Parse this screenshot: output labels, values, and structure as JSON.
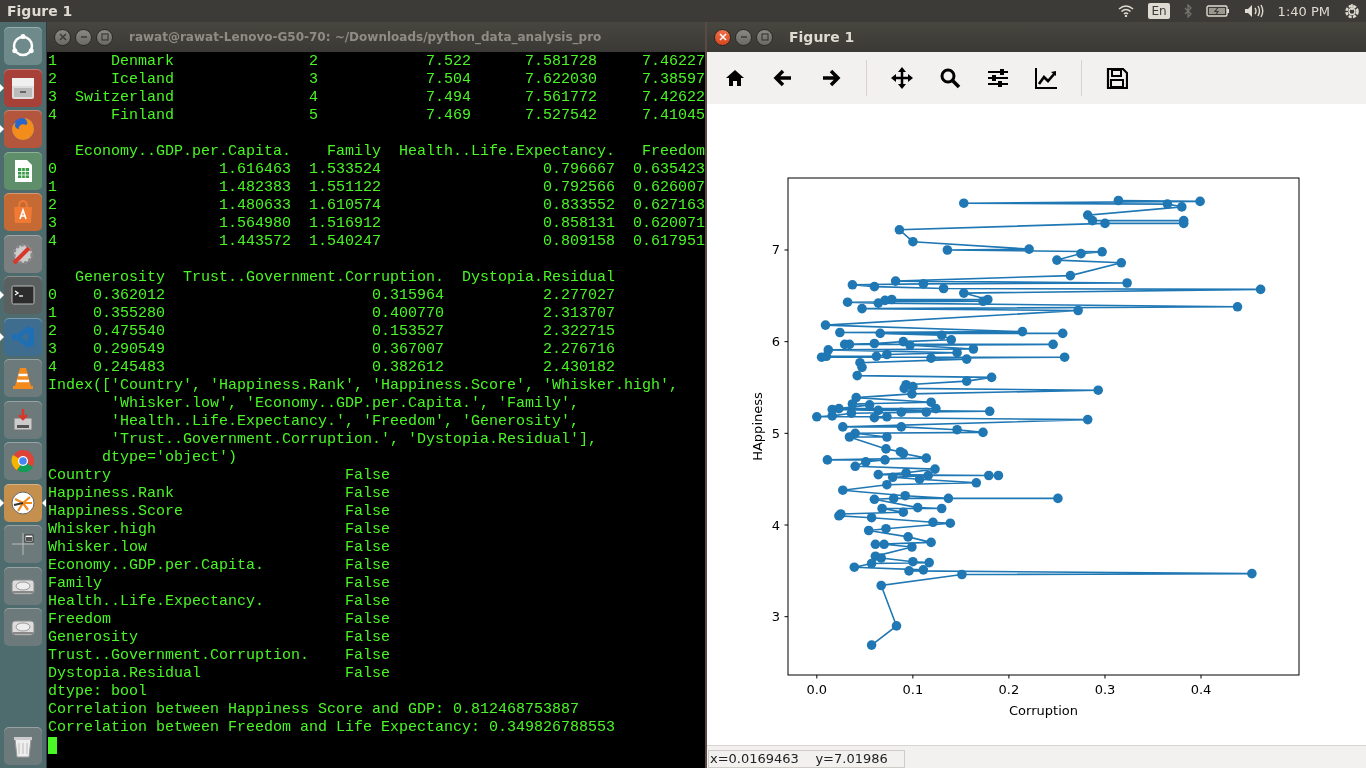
{
  "top_bar": {
    "title": "Figure 1",
    "keyboard": "En",
    "clock": "1:40 PM"
  },
  "launcher": {
    "items": [
      {
        "kind": "ubuntu",
        "running": false,
        "focused": false
      },
      {
        "kind": "files",
        "running": true,
        "focused": false
      },
      {
        "kind": "firefox",
        "running": true,
        "focused": false
      },
      {
        "kind": "spreadsheet",
        "running": false,
        "focused": false
      },
      {
        "kind": "store",
        "running": false,
        "focused": false
      },
      {
        "kind": "settings",
        "running": false,
        "focused": false
      },
      {
        "kind": "terminal",
        "running": true,
        "focused": false
      },
      {
        "kind": "editor",
        "running": true,
        "focused": false
      },
      {
        "kind": "cone",
        "running": false,
        "focused": false
      },
      {
        "kind": "installer",
        "running": false,
        "focused": false
      },
      {
        "kind": "browser",
        "running": false,
        "focused": false
      },
      {
        "kind": "pinwheel",
        "running": true,
        "focused": true
      },
      {
        "kind": "workspaces",
        "running": false,
        "focused": false
      },
      {
        "kind": "disk",
        "running": false,
        "focused": false
      },
      {
        "kind": "disk",
        "running": false,
        "focused": false
      },
      {
        "kind": "trash",
        "running": false,
        "focused": false
      }
    ]
  },
  "terminal": {
    "title": "rawat@rawat-Lenovo-G50-70: ~/Downloads/python_data_analysis_pro",
    "focused": false,
    "blocks": [
      [
        "1      Denmark               2            7.522      7.581728     7.46227",
        "2      Iceland               3            7.504      7.622030     7.38597",
        "3  Switzerland               4            7.494      7.561772     7.42622",
        "4      Finland               5            7.469      7.527542     7.41045"
      ],
      [
        "   Economy..GDP.per.Capita.    Family  Health..Life.Expectancy.   Freedom",
        "0                  1.616463  1.533524                  0.796667  0.635423",
        "1                  1.482383  1.551122                  0.792566  0.626007",
        "2                  1.480633  1.610574                  0.833552  0.627163",
        "3                  1.564980  1.516912                  0.858131  0.620071",
        "4                  1.443572  1.540247                  0.809158  0.617951"
      ],
      [
        "   Generosity  Trust..Government.Corruption.  Dystopia.Residual",
        "0    0.362012                       0.315964           2.277027",
        "1    0.355280                       0.400770           2.313707",
        "2    0.475540                       0.153527           2.322715",
        "3    0.290549                       0.367007           2.276716",
        "4    0.245483                       0.382612           2.430182",
        "Index(['Country', 'Happiness.Rank', 'Happiness.Score', 'Whisker.high',",
        "       'Whisker.low', 'Economy..GDP.per.Capita.', 'Family',",
        "       'Health..Life.Expectancy.', 'Freedom', 'Generosity',",
        "       'Trust..Government.Corruption.', 'Dystopia.Residual'],",
        "      dtype='object')",
        "Country                          False",
        "Happiness.Rank                   False",
        "Happiness.Score                  False",
        "Whisker.high                     False",
        "Whisker.low                      False",
        "Economy..GDP.per.Capita.         False",
        "Family                           False",
        "Health..Life.Expectancy.         False",
        "Freedom                          False",
        "Generosity                       False",
        "Trust..Government.Corruption.    False",
        "Dystopia.Residual                False",
        "dtype: bool",
        "Correlation between Happiness Score and GDP: 0.812468753887",
        "Correlation between Freedom and Life Expectancy: 0.349826788553"
      ]
    ]
  },
  "figure": {
    "title": "Figure 1",
    "focused": true,
    "toolbar": [
      {
        "kind": "home"
      },
      {
        "kind": "back"
      },
      {
        "kind": "forward"
      },
      {
        "kind": "separator"
      },
      {
        "kind": "pan"
      },
      {
        "kind": "zoom"
      },
      {
        "kind": "subplots"
      },
      {
        "kind": "axes"
      },
      {
        "kind": "separator"
      },
      {
        "kind": "save"
      }
    ],
    "plot": {
      "chart_data": {
        "type": "line",
        "xlabel": "Corruption",
        "ylabel": "HAppiness",
        "xlim": [
          -0.03,
          0.502
        ],
        "ylim": [
          2.364,
          7.785
        ],
        "xticks": [
          {
            "value": 0,
            "label": "0.0"
          },
          {
            "value": 0.1,
            "label": "0.1"
          },
          {
            "value": 0.2,
            "label": "0.2"
          },
          {
            "value": 0.3,
            "label": "0.3"
          },
          {
            "value": 0.4,
            "label": "0.4"
          }
        ],
        "yticks": [
          3,
          4,
          5,
          6,
          7
        ],
        "x": [
          0.314,
          0.399,
          0.153,
          0.365,
          0.38,
          0.282,
          0.287,
          0.382,
          0.382,
          0.3,
          0.086,
          0.1,
          0.221,
          0.136,
          0.297,
          0.275,
          0.25,
          0.317,
          0.264,
          0.082,
          0.323,
          0.111,
          0.037,
          0.06,
          0.132,
          0.462,
          0.153,
          0.178,
          0.078,
          0.071,
          0.173,
          0.032,
          0.064,
          0.438,
          0.047,
          0.272,
          0.009,
          0.214,
          0.024,
          0.256,
          0.066,
          0.13,
          0.14,
          0.09,
          0.06,
          0.029,
          0.034,
          0.246,
          0.097,
          0.163,
          0.012,
          0.146,
          0.073,
          0.062,
          0.01,
          0.005,
          0.258,
          0.119,
          0.156,
          0.045,
          0.047,
          0.042,
          0.182,
          0.156,
          0.093,
          0.1,
          0.091,
          0.293,
          0.099,
          0.041,
          0.119,
          0.037,
          0.055,
          0.023,
          0.124,
          0.016,
          0.064,
          0.18,
          0.088,
          0.114,
          0.036,
          0.016,
          0.0,
          0.073,
          0.06,
          0.282,
          0.027,
          0.088,
          0.146,
          0.173,
          0.04,
          0.073,
          0.034,
          0.072,
          0.087,
          0.09,
          0.114,
          0.011,
          0.071,
          0.051,
          0.04,
          0.123,
          0.093,
          0.064,
          0.179,
          0.189,
          0.116,
          0.079,
          0.107,
          0.166,
          0.073,
          0.027,
          0.092,
          0.137,
          0.251,
          0.08,
          0.06,
          0.105,
          0.13,
          0.068,
          0.09,
          0.025,
          0.023,
          0.057,
          0.121,
          0.139,
          0.072,
          0.054,
          0.095,
          0.119,
          0.061,
          0.07,
          0.099,
          0.061,
          0.067,
          0.1,
          0.117,
          0.057,
          0.039,
          0.111,
          0.096,
          0.453,
          0.151,
          0.067,
          0.083,
          0.057
        ],
        "series": [
          {
            "color": "#1f77b4",
            "marker": "o",
            "values": [
              7.54,
              7.53,
              7.51,
              7.5,
              7.47,
              7.38,
              7.32,
              7.32,
              7.29,
              7.29,
              7.22,
              7.09,
              7.01,
              7.0,
              6.98,
              6.96,
              6.89,
              6.86,
              6.72,
              6.66,
              6.64,
              6.63,
              6.62,
              6.6,
              6.58,
              6.57,
              6.53,
              6.46,
              6.46,
              6.45,
              6.44,
              6.43,
              6.42,
              6.38,
              6.36,
              6.34,
              6.18,
              6.11,
              6.1,
              6.09,
              6.09,
              6.07,
              6.02,
              6.0,
              5.98,
              5.97,
              5.97,
              5.97,
              5.96,
              5.92,
              5.91,
              5.88,
              5.86,
              5.84,
              5.84,
              5.83,
              5.83,
              5.82,
              5.81,
              5.77,
              5.72,
              5.63,
              5.61,
              5.57,
              5.53,
              5.51,
              5.49,
              5.47,
              5.43,
              5.39,
              5.34,
              5.32,
              5.31,
              5.27,
              5.27,
              5.26,
              5.25,
              5.24,
              5.23,
              5.23,
              5.22,
              5.19,
              5.18,
              5.18,
              5.17,
              5.15,
              5.07,
              5.07,
              5.04,
              5.01,
              5.0,
              4.96,
              4.96,
              4.83,
              4.8,
              4.78,
              4.73,
              4.71,
              4.71,
              4.69,
              4.64,
              4.61,
              4.57,
              4.55,
              4.54,
              4.54,
              4.54,
              4.52,
              4.5,
              4.46,
              4.44,
              4.38,
              4.32,
              4.29,
              4.29,
              4.29,
              4.28,
              4.19,
              4.18,
              4.18,
              4.14,
              4.12,
              4.1,
              4.08,
              4.03,
              4.02,
              3.96,
              3.94,
              3.87,
              3.81,
              3.79,
              3.79,
              3.76,
              3.66,
              3.64,
              3.6,
              3.59,
              3.58,
              3.54,
              3.51,
              3.5,
              3.47,
              3.46,
              3.34,
              2.9,
              2.69
            ]
          }
        ]
      }
    },
    "status": "x=0.0169463    y=7.01986"
  }
}
